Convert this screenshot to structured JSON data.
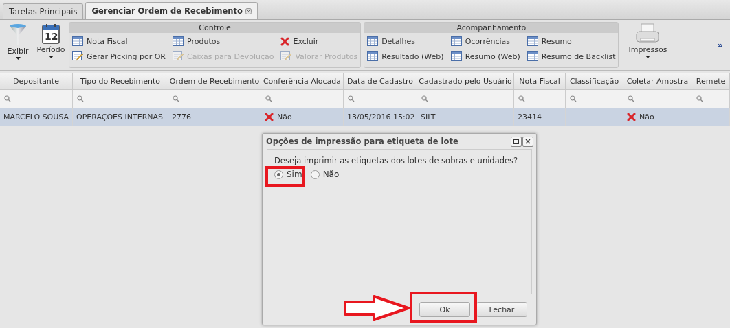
{
  "tabs": [
    {
      "label": "Tarefas Principais",
      "selected": false,
      "closable": false
    },
    {
      "label": "Gerenciar Ordem de Recebimento",
      "selected": true,
      "closable": true
    }
  ],
  "toolbar": {
    "big_buttons": [
      {
        "label": "Exibir",
        "kind": "funnel"
      },
      {
        "label": "Período",
        "kind": "calendar",
        "day": "12"
      }
    ],
    "groups": [
      {
        "title": "Controle",
        "items": [
          {
            "label": "Nota Fiscal",
            "kind": "table",
            "disabled": false
          },
          {
            "label": "Gerar Picking por OR",
            "kind": "edit",
            "disabled": false
          },
          {
            "label": "Produtos",
            "kind": "table",
            "disabled": false
          },
          {
            "label": "Caixas para Devolução",
            "kind": "edit",
            "disabled": true
          },
          {
            "label": "Excluir",
            "kind": "delete",
            "disabled": false
          },
          {
            "label": "Valorar Produtos",
            "kind": "edit",
            "disabled": true
          }
        ]
      },
      {
        "title": "Acompanhamento",
        "items": [
          {
            "label": "Detalhes",
            "kind": "table",
            "disabled": false
          },
          {
            "label": "Resultado (Web)",
            "kind": "table",
            "disabled": false
          },
          {
            "label": "Ocorrências",
            "kind": "table",
            "disabled": false
          },
          {
            "label": "Resumo (Web)",
            "kind": "table",
            "disabled": false
          },
          {
            "label": "Resumo",
            "kind": "table",
            "disabled": false
          },
          {
            "label": "Resumo de Backlist",
            "kind": "table",
            "disabled": false
          }
        ]
      }
    ],
    "print_button": {
      "label": "Impressos"
    },
    "more": "»"
  },
  "table": {
    "columns": [
      "Depositante",
      "Tipo do Recebimento",
      "Ordem de Recebimento",
      "Conferência Alocada",
      "Data de Cadastro",
      "Cadastrado pelo Usuário",
      "Nota Fiscal",
      "Classificação",
      "Coletar Amostra",
      "Remete"
    ],
    "rows": [
      {
        "selected": true,
        "cells": [
          {
            "text": "MARCELO SOUSA",
            "kind": "text"
          },
          {
            "text": "OPERAÇÕES INTERNAS",
            "kind": "text"
          },
          {
            "text": "2776",
            "kind": "text"
          },
          {
            "text": "Não",
            "kind": "cross"
          },
          {
            "text": "13/05/2016 15:02",
            "kind": "text"
          },
          {
            "text": "SILT",
            "kind": "text"
          },
          {
            "text": "23414",
            "kind": "text"
          },
          {
            "text": "",
            "kind": "empty"
          },
          {
            "text": "Não",
            "kind": "cross"
          },
          {
            "text": "",
            "kind": "empty"
          }
        ]
      }
    ]
  },
  "dialog": {
    "title": "Opções de impressão para etiqueta de lote",
    "question": "Deseja imprimir as etiquetas dos lotes de sobras e unidades?",
    "options": [
      {
        "label": "Sim",
        "selected": true
      },
      {
        "label": "Não",
        "selected": false
      }
    ],
    "buttons": [
      "Ok",
      "Fechar"
    ]
  }
}
